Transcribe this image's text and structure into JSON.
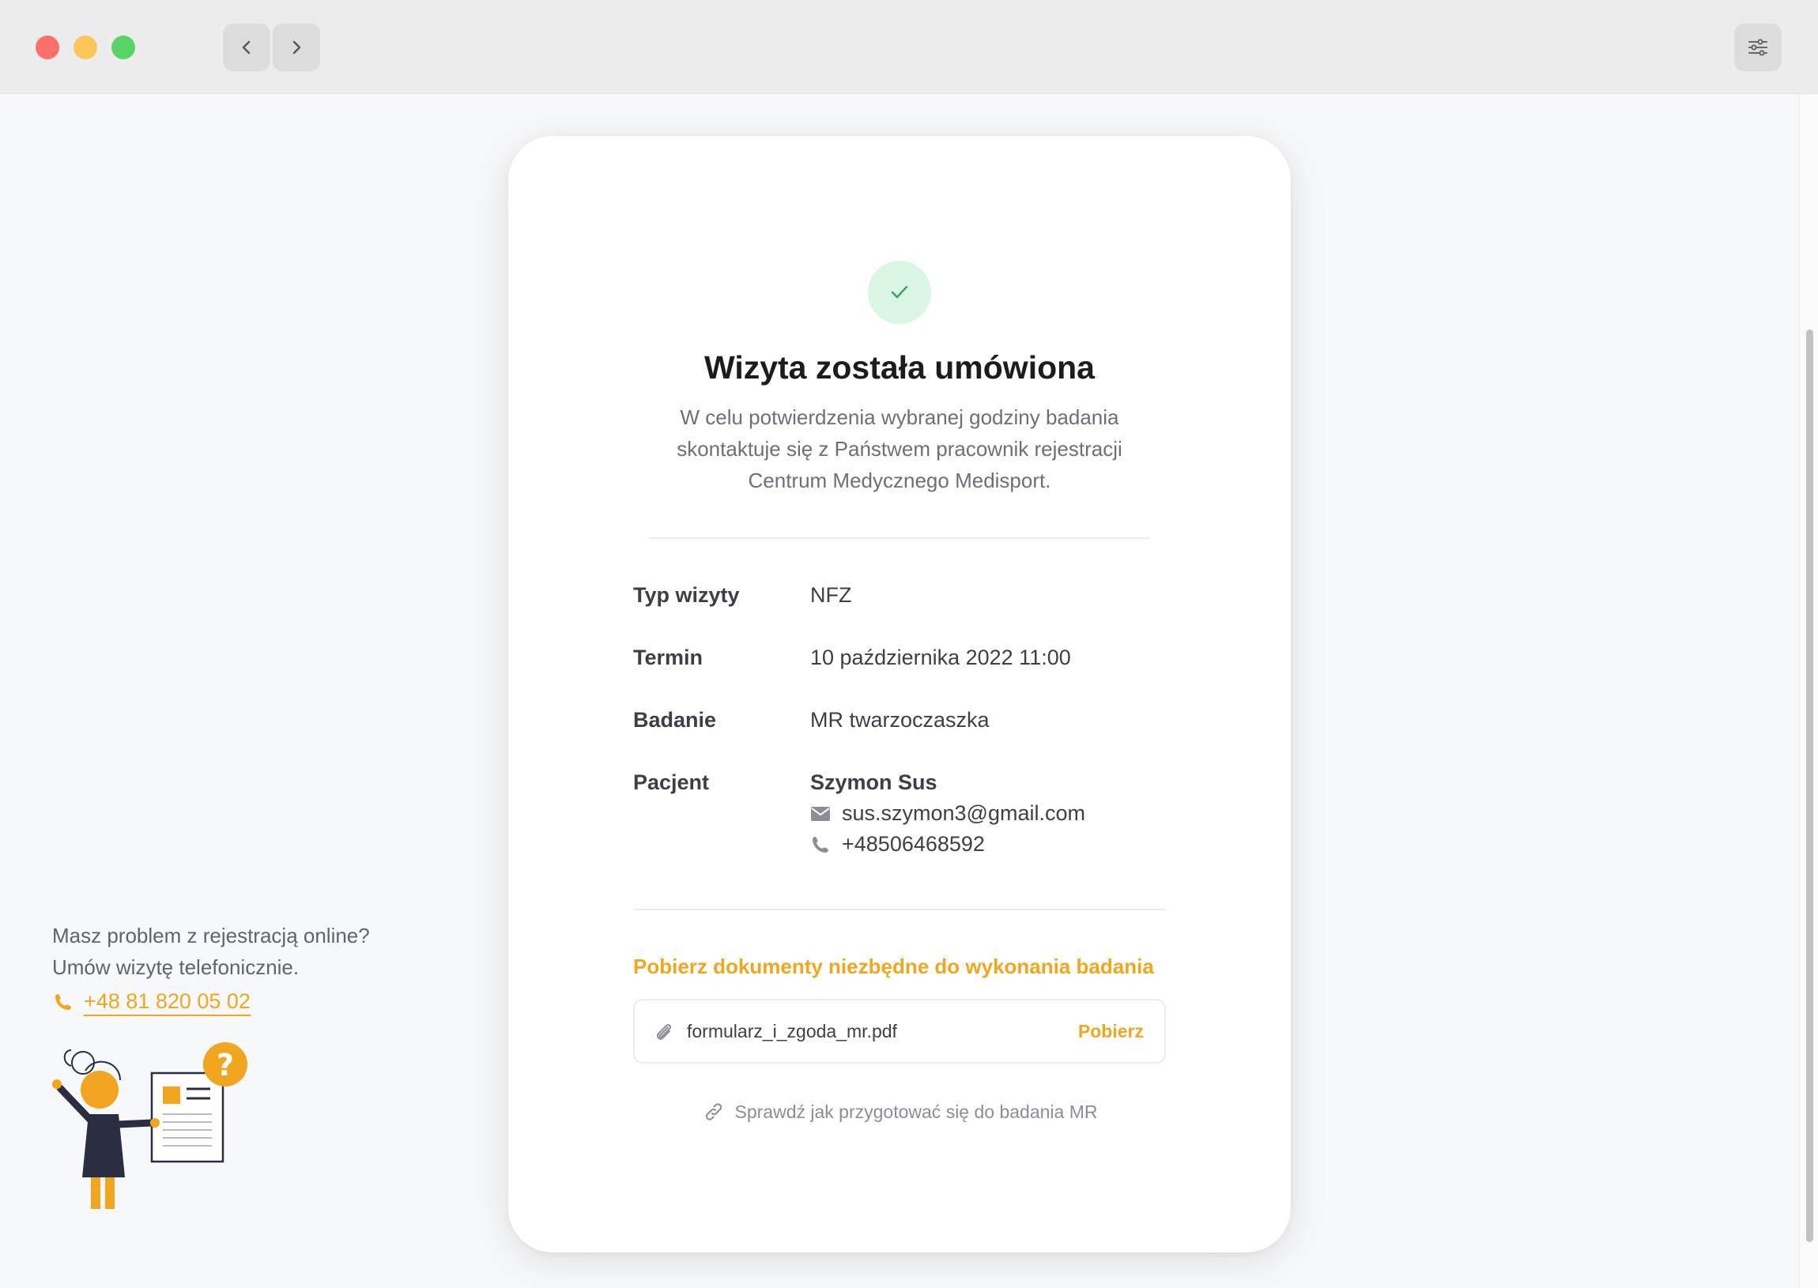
{
  "window": {
    "nav_back_icon": "chevron-left-icon",
    "nav_forward_icon": "chevron-right-icon",
    "settings_icon": "sliders-icon"
  },
  "card": {
    "status_icon": "check-icon",
    "title": "Wizyta została umówiona",
    "description": "W celu potwierdzenia wybranej godziny badania skontaktuje się z Państwem pracownik rejestracji Centrum Medycznego Medisport.",
    "details": {
      "visit_type_label": "Typ wizyty",
      "visit_type_value": "NFZ",
      "term_label": "Termin",
      "term_value": "10 października 2022 11:00",
      "exam_label": "Badanie",
      "exam_value": "MR twarzoczaszka",
      "patient_label": "Pacjent",
      "patient_name": "Szymon Sus",
      "patient_email": "sus.szymon3@gmail.com",
      "patient_phone": "+48506468592"
    },
    "documents": {
      "title": "Pobierz dokumenty niezbędne do wykonania badania",
      "file_name": "formularz_i_zgoda_mr.pdf",
      "download_label": "Pobierz"
    },
    "prep_link": "Sprawdź jak przygotować się do badania MR"
  },
  "help": {
    "line1": "Masz problem z rejestracją online?",
    "line2": "Umów wizytę telefonicznie.",
    "phone": "+48 81 820 05 02"
  },
  "colors": {
    "accent": "#f2a51f",
    "success_bg": "#d9f5e4",
    "success": "#3f9a63"
  }
}
